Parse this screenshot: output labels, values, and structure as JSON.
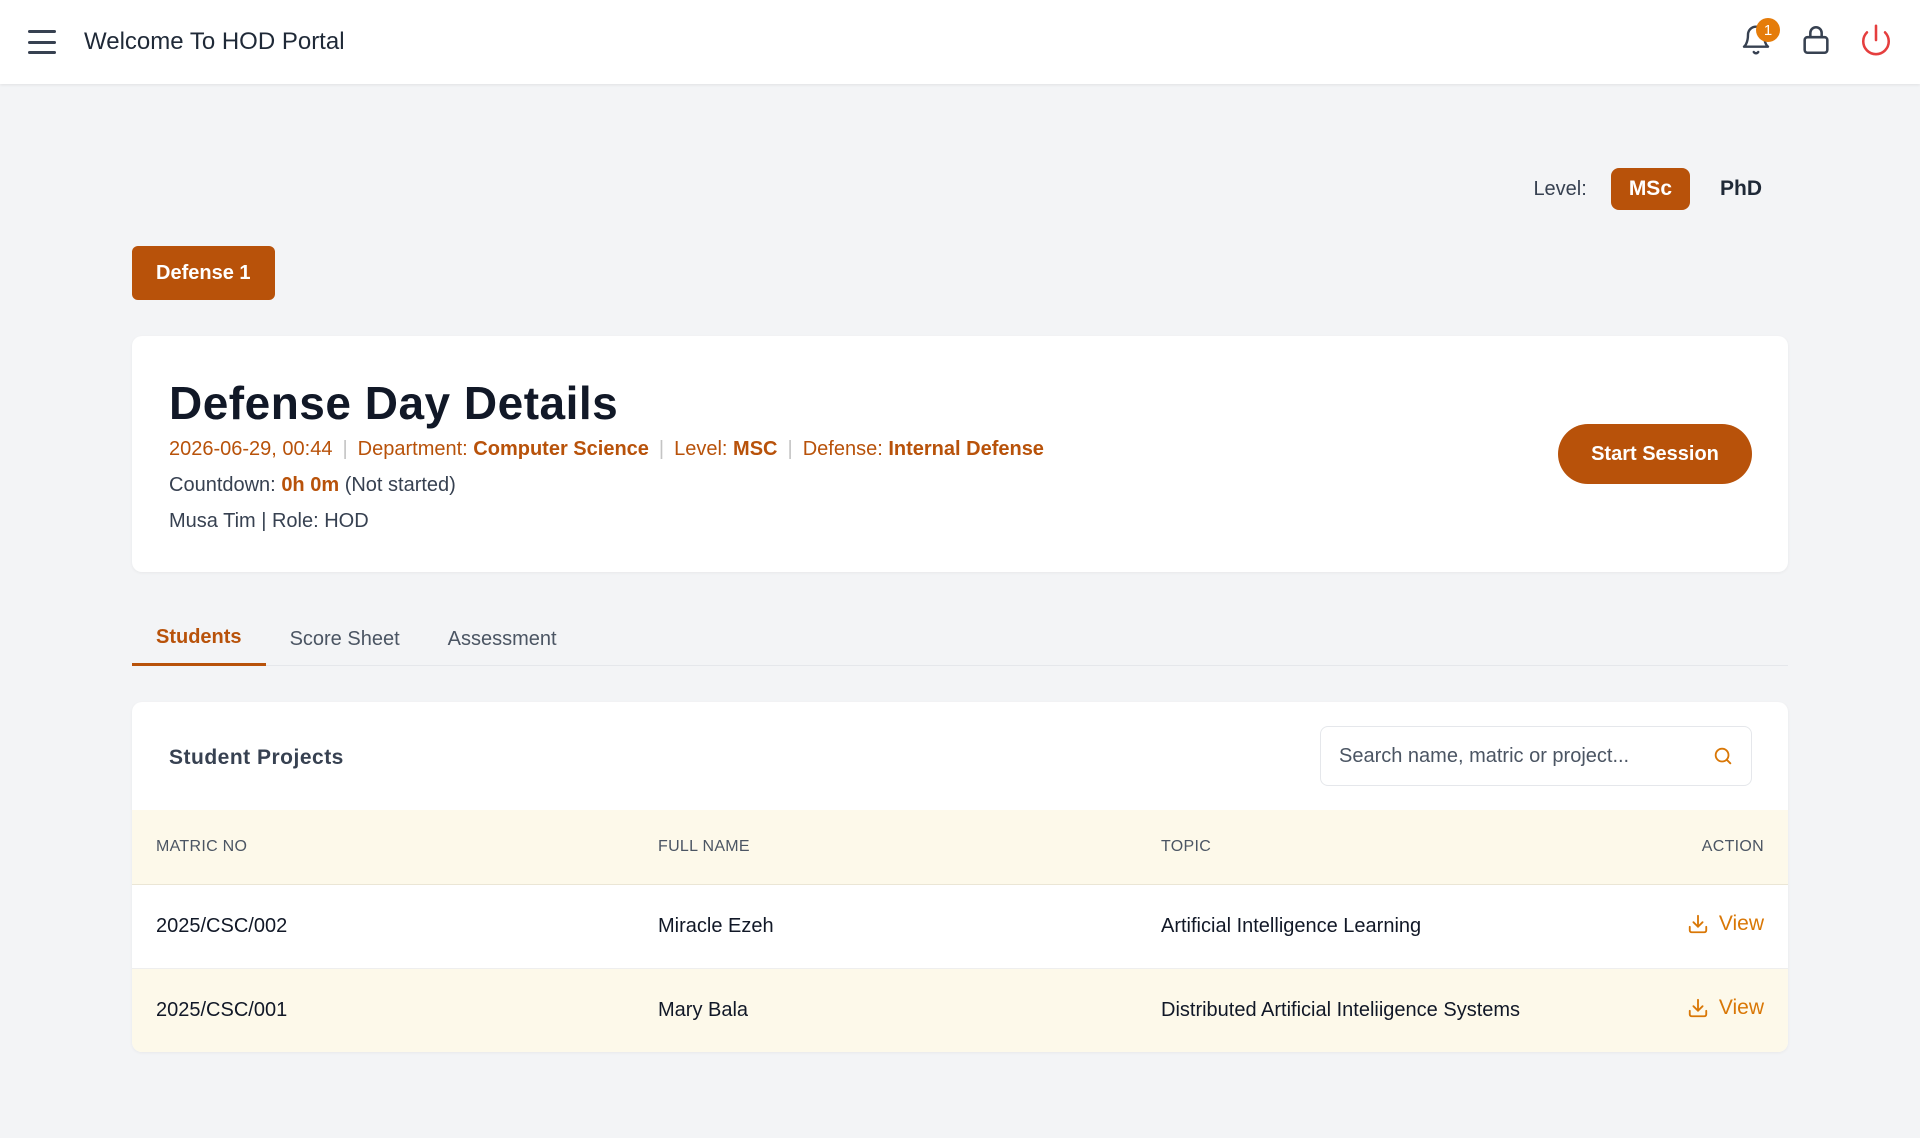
{
  "header": {
    "title": "Welcome To HOD Portal",
    "notification_count": "1"
  },
  "level": {
    "label": "Level:",
    "options": [
      "MSc",
      "PhD"
    ],
    "selected": "MSc"
  },
  "defense_tab": {
    "label": "Defense 1"
  },
  "details": {
    "title": "Defense Day Details",
    "datetime": "2026-06-29, 00:44",
    "department_label": "Department:",
    "department": "Computer Science",
    "level_label": "Level:",
    "level": "MSC",
    "defense_label": "Defense:",
    "defense": "Internal Defense",
    "countdown_label": "Countdown:",
    "countdown_value": "0h 0m",
    "countdown_status": "(Not started)",
    "user_role": "Musa Tim | Role: HOD",
    "start_button": "Start Session"
  },
  "tabs": [
    "Students",
    "Score Sheet",
    "Assessment"
  ],
  "active_tab": "Students",
  "projects": {
    "title": "Student Projects",
    "search_placeholder": "Search name, matric or project...",
    "columns": [
      "MATRIC NO",
      "FULL NAME",
      "TOPIC",
      "ACTION"
    ],
    "rows": [
      {
        "matric": "2025/CSC/002",
        "name": "Miracle Ezeh",
        "topic": "Artificial Intelligence Learning",
        "action": "View"
      },
      {
        "matric": "2025/CSC/001",
        "name": "Mary Bala",
        "topic": "Distributed Artificial Inteliigence Systems",
        "action": "View"
      }
    ]
  },
  "colors": {
    "accent": "#b8520a",
    "link": "#d97706",
    "badge": "#e57c0a",
    "power": "#e53e3e",
    "row_highlight": "#fdf9ea"
  }
}
